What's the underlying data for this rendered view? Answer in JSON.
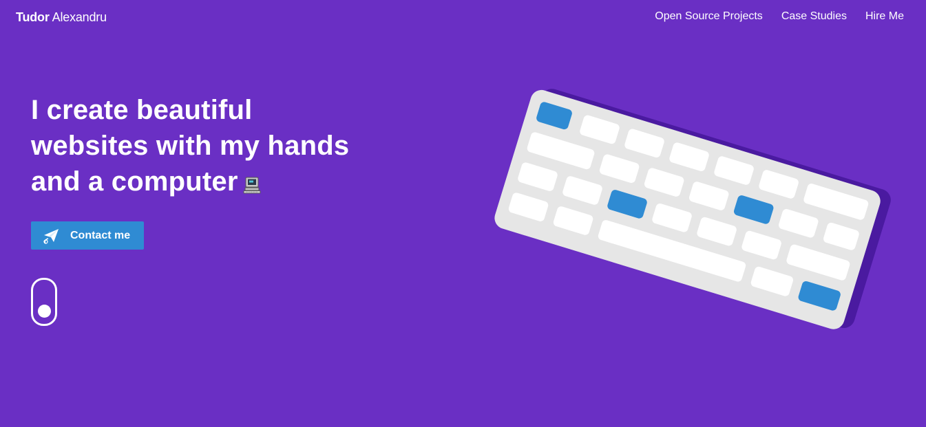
{
  "header": {
    "brand_first": "Tudor",
    "brand_last": "Alexandru",
    "nav": [
      {
        "label": "Open Source Projects"
      },
      {
        "label": "Case Studies"
      },
      {
        "label": "Hire Me"
      }
    ]
  },
  "hero": {
    "headline_lines": [
      "I create beautiful",
      "websites with my hands",
      "and a computer"
    ],
    "headline_icon": "desktop-computer-icon",
    "cta_label": "Contact me",
    "cta_icon": "paper-plane-icon"
  },
  "illustration": {
    "name": "keyboard-illustration",
    "colors": {
      "body": "#e6e6e6",
      "shadow": "#4a1aa0",
      "key": "#ffffff",
      "accent_key": "#2f8bd3"
    }
  },
  "colors": {
    "background": "#6a2fc4",
    "accent": "#2f8bd3",
    "text": "#ffffff"
  }
}
